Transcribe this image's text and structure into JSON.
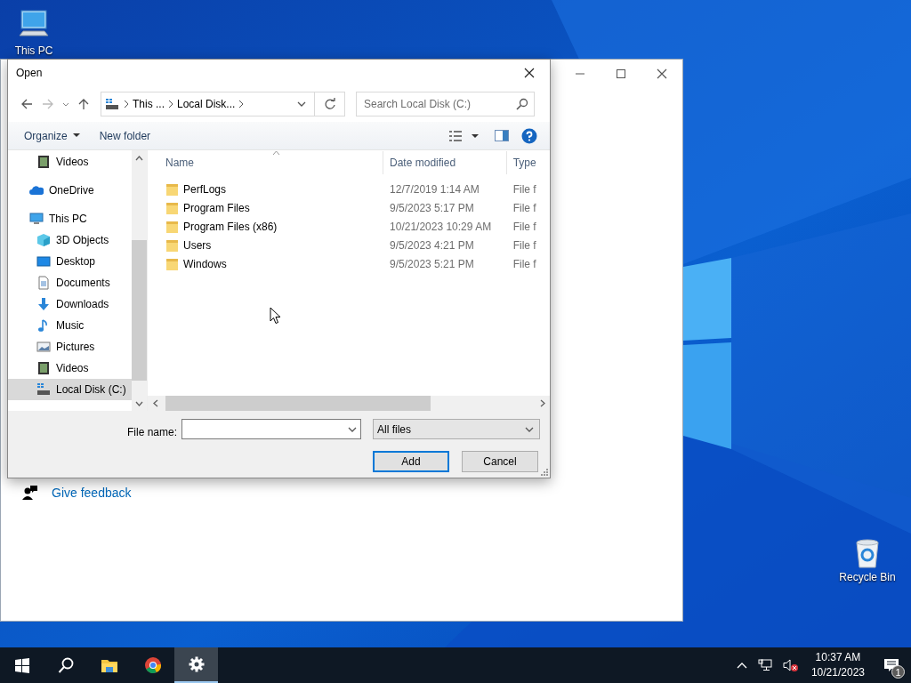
{
  "desktop": {
    "icons": [
      {
        "kind": "pc",
        "label": "This PC"
      },
      {
        "kind": "bin",
        "label": "Recycle Bin"
      }
    ]
  },
  "settings_window": {
    "links": [
      {
        "label": "Give feedback"
      }
    ]
  },
  "dialog": {
    "title": "Open",
    "breadcrumb": [
      "This ...",
      "Local Disk..."
    ],
    "search": {
      "placeholder": "Search Local Disk (C:)"
    },
    "toolbar": [
      {
        "label": "Organize",
        "menu": true
      },
      {
        "label": "New folder",
        "menu": false
      }
    ],
    "nav_tree": [
      {
        "children": [
          {
            "label": "Videos",
            "kind": "videos",
            "selected": false
          }
        ]
      },
      {
        "label": "OneDrive",
        "kind": "onedrive",
        "selected": false
      },
      {
        "label": "This PC",
        "kind": "pc",
        "selected": false,
        "children": [
          {
            "label": "3D Objects",
            "kind": "objects",
            "selected": false
          },
          {
            "label": "Desktop",
            "kind": "desktop",
            "selected": false
          },
          {
            "label": "Documents",
            "kind": "documents",
            "selected": false
          },
          {
            "label": "Downloads",
            "kind": "downloads",
            "selected": false
          },
          {
            "label": "Music",
            "kind": "music",
            "selected": false
          },
          {
            "label": "Pictures",
            "kind": "pictures",
            "selected": false
          },
          {
            "label": "Videos",
            "kind": "videos",
            "selected": false
          },
          {
            "label": "Local Disk (C:)",
            "kind": "disk",
            "selected": true
          }
        ]
      }
    ],
    "columns": [
      {
        "label": "Name",
        "sorted": true
      },
      {
        "label": "Date modified",
        "sorted": false
      },
      {
        "label": "Type",
        "sorted": false
      }
    ],
    "rows": [
      {
        "name": "PerfLogs",
        "date": "12/7/2019 1:14 AM",
        "type": "File f"
      },
      {
        "name": "Program Files",
        "date": "9/5/2023 5:17 PM",
        "type": "File f"
      },
      {
        "name": "Program Files (x86)",
        "date": "10/21/2023 10:29 AM",
        "type": "File f"
      },
      {
        "name": "Users",
        "date": "9/5/2023 4:21 PM",
        "type": "File f"
      },
      {
        "name": "Windows",
        "date": "9/5/2023 5:21 PM",
        "type": "File f"
      }
    ],
    "file_name": {
      "label": "File name:"
    },
    "file_type": {
      "value": "All files"
    },
    "buttons": [
      {
        "label": "Add",
        "default": true
      },
      {
        "label": "Cancel",
        "default": false
      }
    ]
  },
  "taskbar": {
    "items": [
      {
        "kind": "start",
        "active": false
      },
      {
        "kind": "search",
        "active": false
      },
      {
        "kind": "explorer",
        "active": false
      },
      {
        "kind": "browser",
        "active": false
      },
      {
        "kind": "settings",
        "active": true
      }
    ],
    "time": "10:37 AM",
    "date": "10/21/2023",
    "notifications": "1"
  }
}
